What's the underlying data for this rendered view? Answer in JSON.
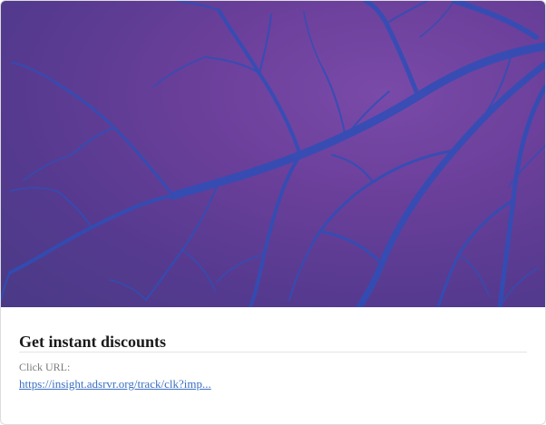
{
  "ad": {
    "title": "Get instant discounts",
    "click_label": "Click URL:",
    "click_url": "https://insight.adsrvr.org/track/clk?imp...",
    "image_description": "purple-sky-with-blue-bare-tree-branches"
  },
  "colors": {
    "hero_purple": "#6a3f9a",
    "branch_blue": "#2e4fb8",
    "link": "#3b6fc2",
    "title": "#1a1a1a",
    "label": "#7a7a7a"
  }
}
